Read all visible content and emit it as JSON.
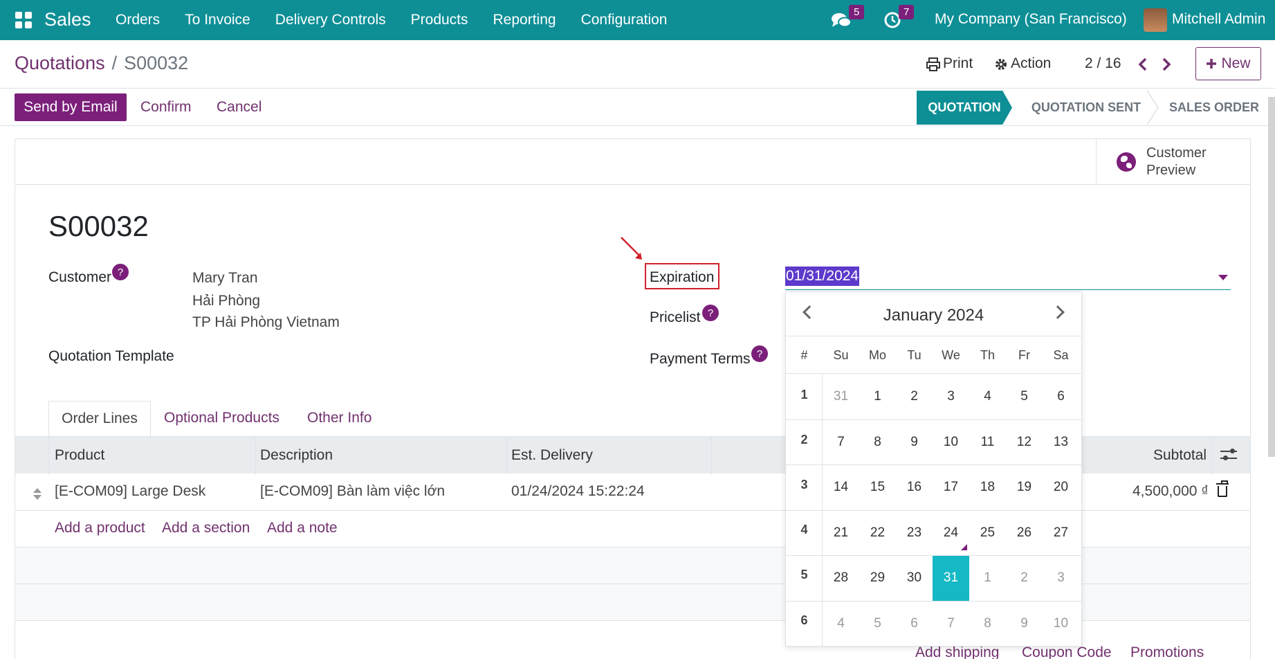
{
  "navbar": {
    "app_name": "Sales",
    "menu": [
      "Orders",
      "To Invoice",
      "Delivery Controls",
      "Products",
      "Reporting",
      "Configuration"
    ],
    "messages_count": "5",
    "activities_count": "7",
    "company": "My Company (San Francisco)",
    "user": "Mitchell Admin"
  },
  "breadcrumb": {
    "parent": "Quotations",
    "separator": "/",
    "current": "S00032"
  },
  "control": {
    "print_label": "Print",
    "action_label": "Action",
    "pager": "2 / 16",
    "new_label": "New"
  },
  "statusbar": {
    "send_email": "Send by Email",
    "confirm": "Confirm",
    "cancel": "Cancel",
    "stages": [
      "QUOTATION",
      "QUOTATION SENT",
      "SALES ORDER"
    ],
    "active_stage": "QUOTATION"
  },
  "sheet": {
    "customer_preview": "Customer Preview",
    "record_name": "S00032",
    "customer_label": "Customer",
    "customer_name": "Mary Tran",
    "customer_city": "Hải Phòng",
    "customer_region": "TP Hải Phòng Vietnam",
    "template_label": "Quotation Template",
    "expiration_label": "Expiration",
    "expiration_value": "01/31/2024",
    "pricelist_label": "Pricelist",
    "payment_terms_label": "Payment Terms",
    "help_mark": "?"
  },
  "tabs": [
    "Order Lines",
    "Optional Products",
    "Other Info"
  ],
  "table": {
    "headers": {
      "product": "Product",
      "description": "Description",
      "delivery": "Est. Delivery",
      "subtotal": "Subtotal"
    },
    "rows": [
      {
        "product": "[E-COM09] Large Desk",
        "description": "[E-COM09] Bàn làm việc lớn",
        "delivery": "01/24/2024 15:22:24",
        "subtotal": "4,500,000 ₫"
      }
    ],
    "add_links": [
      "Add a product",
      "Add a section",
      "Add a note"
    ]
  },
  "footer_links": [
    "Add shipping",
    "Coupon Code",
    "Promotions"
  ],
  "datepicker": {
    "month_title": "January 2024",
    "week_header": "#",
    "weekdays": [
      "Su",
      "Mo",
      "Tu",
      "We",
      "Th",
      "Fr",
      "Sa"
    ],
    "weeks": [
      {
        "num": "1",
        "days": [
          "31",
          "1",
          "2",
          "3",
          "4",
          "5",
          "6"
        ]
      },
      {
        "num": "2",
        "days": [
          "7",
          "8",
          "9",
          "10",
          "11",
          "12",
          "13"
        ]
      },
      {
        "num": "3",
        "days": [
          "14",
          "15",
          "16",
          "17",
          "18",
          "19",
          "20"
        ]
      },
      {
        "num": "4",
        "days": [
          "21",
          "22",
          "23",
          "24",
          "25",
          "26",
          "27"
        ]
      },
      {
        "num": "5",
        "days": [
          "28",
          "29",
          "30",
          "31",
          "1",
          "2",
          "3"
        ]
      },
      {
        "num": "6",
        "days": [
          "4",
          "5",
          "6",
          "7",
          "8",
          "9",
          "10"
        ]
      }
    ],
    "selected": "31"
  },
  "colors": {
    "navbar": "#0e8f96",
    "primary": "#7b1f7a",
    "selected_day": "#15b8c5",
    "highlight_box": "#d21f2a"
  }
}
